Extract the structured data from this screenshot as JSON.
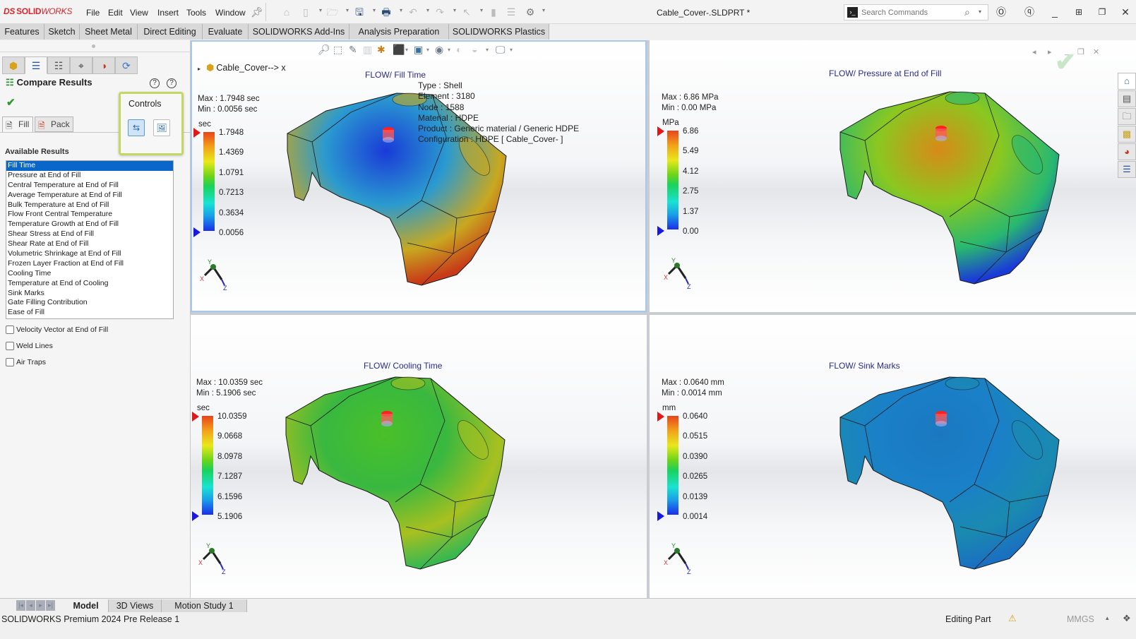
{
  "app": {
    "brand_prefix": "DS",
    "brand_solid": "SOLID",
    "brand_works": "WORKS",
    "document_title": "Cable_Cover-.SLDPRT *"
  },
  "menu": [
    "File",
    "Edit",
    "View",
    "Insert",
    "Tools",
    "Window"
  ],
  "search": {
    "placeholder": "Search Commands"
  },
  "command_tabs": [
    "Features",
    "Sketch",
    "Sheet Metal",
    "Direct Editing",
    "Evaluate",
    "SOLIDWORKS Add-Ins",
    "Analysis Preparation",
    "SOLIDWORKS Plastics"
  ],
  "property_manager": {
    "title": "Compare Results",
    "subtabs": [
      "Fill",
      "Pack"
    ],
    "available_results_label": "Available Results",
    "results": [
      "Fill Time",
      "Pressure at End of Fill",
      "Central Temperature at End of Fill",
      "Average Temperature at End of Fill",
      "Bulk Temperature at End of Fill",
      "Flow Front Central Temperature",
      "Temperature Growth at End of Fill",
      "Shear Stress at End of Fill",
      "Shear Rate at End of Fill",
      "Volumetric Shrinkage at End of Fill",
      "Frozen Layer Fraction at End of Fill",
      "Cooling Time",
      "Temperature at End of Cooling",
      "Sink Marks",
      "Gate Filling Contribution",
      "Ease of Fill"
    ],
    "selected_result": "Fill Time",
    "checkboxes": [
      {
        "label": "Velocity Vector at End of Fill",
        "checked": false
      },
      {
        "label": "Weld Lines",
        "checked": false
      },
      {
        "label": "Air Traps",
        "checked": false
      }
    ]
  },
  "controls_popup": {
    "label": "Controls"
  },
  "feature_tree": {
    "item": "Cable_Cover--> x"
  },
  "viewports": [
    {
      "title": "FLOW/ Fill Time",
      "max": "Max : 1.7948 sec",
      "min": "Min : 0.0056 sec",
      "unit": "sec",
      "ticks": [
        "1.7948",
        "1.4369",
        "1.0791",
        "0.7213",
        "0.3634",
        "0.0056"
      ],
      "info": [
        "Type : Shell",
        "Element : 3180",
        "Node : 1588",
        "Material : HDPE",
        "Product : Generic material / Generic HDPE",
        "Configuration : HDPE [ Cable_Cover- ]"
      ],
      "colors": {
        "main": "#2a9ad0",
        "center": "#1a3ad8",
        "edge": "#c8a820",
        "far": "#c83a18"
      }
    },
    {
      "title": "FLOW/ Pressure at End of Fill",
      "max": "Max : 6.86 MPa",
      "min": "Min : 0.00 MPa",
      "unit": "MPa",
      "ticks": [
        "6.86",
        "5.49",
        "4.12",
        "2.75",
        "1.37",
        "0.00"
      ],
      "colors": {
        "main": "#8ac820",
        "center": "#d88a18",
        "edge": "#28b870",
        "far": "#1a3ad8"
      }
    },
    {
      "title": "FLOW/ Cooling Time",
      "max": "Max : 10.0359 sec",
      "min": "Min : 5.1906 sec",
      "unit": "sec",
      "ticks": [
        "10.0359",
        "9.0668",
        "8.0978",
        "7.1287",
        "6.1596",
        "5.1906"
      ],
      "colors": {
        "main": "#38b840",
        "center": "#4ac028",
        "edge": "#a8c020",
        "far": "#3ab850"
      }
    },
    {
      "title": "FLOW/ Sink Marks",
      "max": "Max : 0.0640 mm",
      "min": "Min : 0.0014 mm",
      "unit": "mm",
      "ticks": [
        "0.0640",
        "0.0515",
        "0.0390",
        "0.0265",
        "0.0139",
        "0.0014"
      ],
      "colors": {
        "main": "#1a80c8",
        "center": "#1a78c0",
        "edge": "#1a8ab0",
        "far": "#1a70c0"
      }
    }
  ],
  "bottom_tabs": [
    "Model",
    "3D Views",
    "Motion Study 1"
  ],
  "status": {
    "version": "SOLIDWORKS Premium 2024 Pre Release 1",
    "mode": "Editing Part",
    "units": "MMGS"
  }
}
